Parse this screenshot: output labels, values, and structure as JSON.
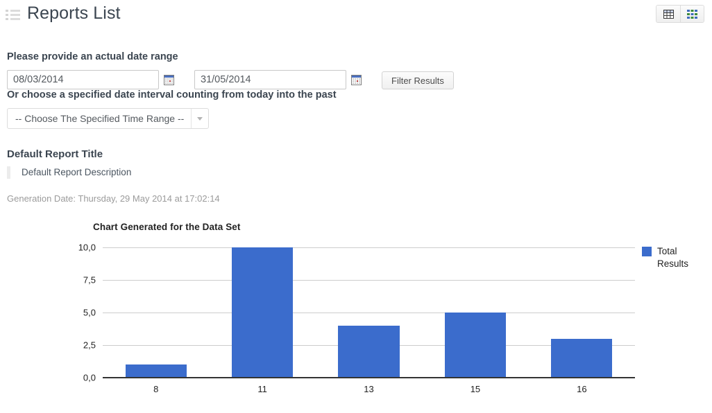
{
  "header": {
    "title": "Reports List",
    "list_icon": "list-icon",
    "view_buttons": [
      {
        "name": "table-view-button",
        "icon": "table-icon"
      },
      {
        "name": "grid-view-button",
        "icon": "grid-icon"
      }
    ]
  },
  "filters": {
    "date_range_label": "Please provide an actual date range",
    "start_date": "08/03/2014",
    "start_date_placeholder": "dd/mm/yyyy",
    "end_date": "31/05/2014",
    "end_date_placeholder": "dd/mm/yyyy",
    "filter_button": "Filter Results",
    "interval_label": "Or choose a specified date interval counting from today into the past",
    "interval_selected": "-- Choose The Specified Time Range --"
  },
  "report": {
    "title": "Default Report Title",
    "description": "Default Report Description",
    "generation_date": "Generation Date: Thursday, 29 May 2014 at 17:02:14"
  },
  "colors": {
    "series": "#3b6ccc",
    "gridline": "#cccccc",
    "axis": "#333333"
  },
  "chart_data": {
    "type": "bar",
    "title": "Chart Generated for the Data Set",
    "categories": [
      "8",
      "11",
      "13",
      "15",
      "16"
    ],
    "series": [
      {
        "name": "Total Results",
        "values": [
          1,
          10,
          4,
          5,
          3
        ],
        "color": "#3b6ccc"
      }
    ],
    "legend_label_line1": "Total",
    "legend_label_line2": "Results",
    "legend_position": "right",
    "xlabel": "",
    "ylabel": "",
    "ylim": [
      0,
      10
    ],
    "yticks": [
      "10,0",
      "7,5",
      "5,0",
      "2,5",
      "0,0"
    ],
    "ytick_values": [
      10,
      7.5,
      5,
      2.5,
      0
    ],
    "grid": true
  }
}
